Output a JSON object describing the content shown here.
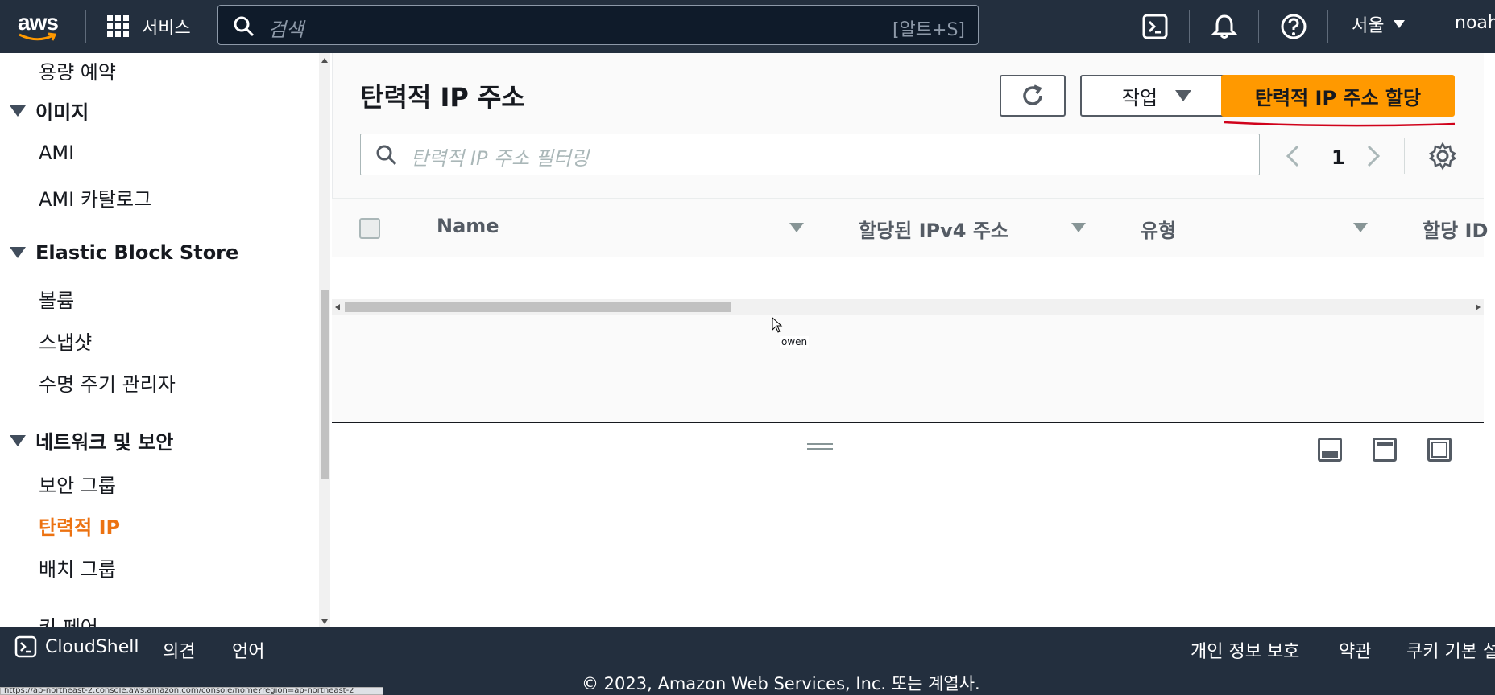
{
  "topnav": {
    "logo": "aws",
    "services_label": "서비스",
    "search_placeholder": "검색",
    "search_shortcut": "[알트+S]",
    "region": "서울",
    "user": "noah"
  },
  "sidebar": {
    "items": [
      {
        "label": "용량 예약",
        "type": "item"
      },
      {
        "label": "이미지",
        "type": "section"
      },
      {
        "label": "AMI",
        "type": "item"
      },
      {
        "label": "AMI 카탈로그",
        "type": "item"
      },
      {
        "label": "Elastic Block Store",
        "type": "section"
      },
      {
        "label": "볼륨",
        "type": "item"
      },
      {
        "label": "스냅샷",
        "type": "item"
      },
      {
        "label": "수명 주기 관리자",
        "type": "item"
      },
      {
        "label": "네트워크 및 보안",
        "type": "section"
      },
      {
        "label": "보안 그룹",
        "type": "item"
      },
      {
        "label": "탄력적 IP",
        "type": "item",
        "active": true
      },
      {
        "label": "배치 그룹",
        "type": "item"
      },
      {
        "label": "키 페어",
        "type": "item"
      }
    ]
  },
  "main": {
    "title": "탄력적 IP 주소",
    "actions_label": "작업",
    "allocate_label": "탄력적 IP 주소 할당",
    "filter_placeholder": "탄력적 IP 주소 필터링",
    "page_number": "1",
    "columns": [
      "Name",
      "할당된 IPv4 주소",
      "유형",
      "할당 ID"
    ],
    "cursor_label": "owen"
  },
  "footer": {
    "cloudshell": "CloudShell",
    "feedback": "의견",
    "language": "언어",
    "privacy": "개인 정보 보호",
    "terms": "약관",
    "cookies": "쿠키 기본 설정",
    "copyright": "© 2023, Amazon Web Services, Inc. 또는 계열사.",
    "status_url": "https://ap-northeast-2.console.aws.amazon.com/console/home?region=ap-northeast-2"
  },
  "colors": {
    "nav_bg": "#232f3e",
    "accent_orange": "#ff9900",
    "active_link": "#ec7211",
    "annotation_red": "#d0021b"
  },
  "icons": {
    "grid": "grid-icon",
    "search": "search-icon",
    "cloudshell": "cloudshell-icon",
    "bell": "bell-icon",
    "help": "help-icon",
    "refresh": "refresh-icon",
    "settings": "gear-icon"
  }
}
